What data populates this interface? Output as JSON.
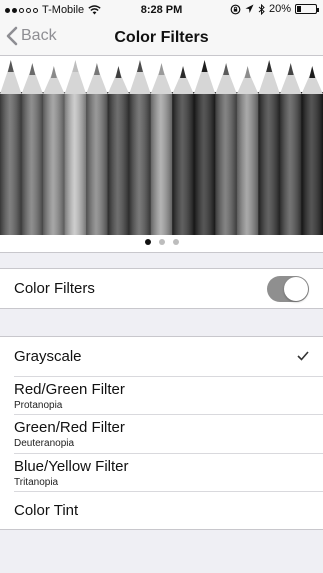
{
  "status_bar": {
    "carrier": "T-Mobile",
    "time": "8:28 PM",
    "battery": "20%",
    "battery_level": 0.2,
    "signal_filled": 2,
    "signal_total": 5
  },
  "nav": {
    "back_label": "Back",
    "title": "Color Filters"
  },
  "hero": {
    "page_count": 3,
    "current_page": 1
  },
  "toggle_section": {
    "label": "Color Filters",
    "enabled": true
  },
  "filters": [
    {
      "title": "Grayscale",
      "subtitle": "",
      "selected": true
    },
    {
      "title": "Red/Green Filter",
      "subtitle": "Protanopia",
      "selected": false
    },
    {
      "title": "Green/Red Filter",
      "subtitle": "Deuteranopia",
      "selected": false
    },
    {
      "title": "Blue/Yellow Filter",
      "subtitle": "Tritanopia",
      "selected": false
    },
    {
      "title": "Color Tint",
      "subtitle": "",
      "selected": false
    }
  ]
}
